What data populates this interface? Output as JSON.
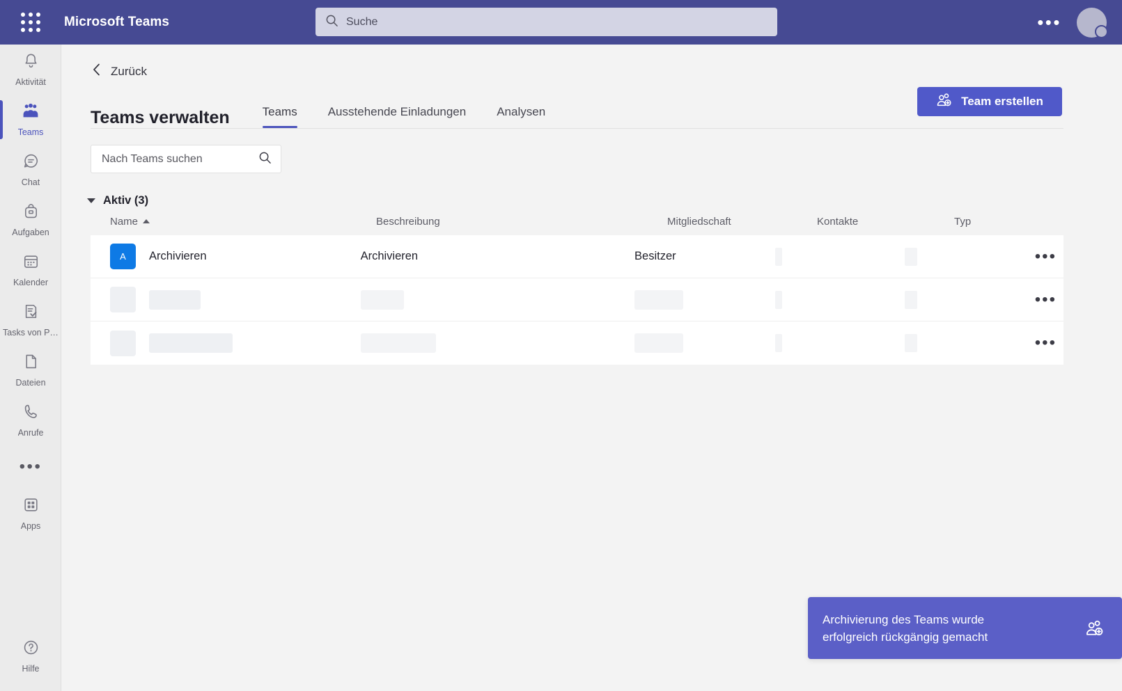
{
  "topbar": {
    "waffle_icon": "app-launcher-icon",
    "brand": "Microsoft Teams",
    "search_placeholder": "Suche",
    "search_value": "",
    "search_icon": "search-icon",
    "more_label": "•••",
    "avatar_icon": "user-avatar"
  },
  "rail": {
    "items": [
      {
        "label": "Aktivität",
        "icon": "bell-icon",
        "active": false
      },
      {
        "label": "Teams",
        "icon": "people-icon",
        "active": true
      },
      {
        "label": "Chat",
        "icon": "chat-bubble-icon",
        "active": false
      },
      {
        "label": "Aufgaben",
        "icon": "backpack-icon",
        "active": false
      },
      {
        "label": "Kalender",
        "icon": "calendar-icon",
        "active": false
      },
      {
        "label": "Tasks von P…",
        "icon": "task-list-icon",
        "active": false
      },
      {
        "label": "Dateien",
        "icon": "file-icon",
        "active": false
      },
      {
        "label": "Anrufe",
        "icon": "phone-icon",
        "active": false
      }
    ],
    "more_label": "•••",
    "apps": {
      "label": "Apps",
      "icon": "grid-apps-icon"
    },
    "help": {
      "label": "Hilfe",
      "icon": "question-circle-icon"
    }
  },
  "content": {
    "back_label": "Zurück",
    "back_icon": "chevron-left-icon",
    "page_title": "Teams verwalten",
    "tabs": [
      {
        "label": "Teams",
        "active": true
      },
      {
        "label": "Ausstehende Einladungen",
        "active": false
      },
      {
        "label": "Analysen",
        "active": false
      }
    ],
    "create_button": {
      "label": "Team erstellen",
      "icon": "add-person-icon"
    },
    "team_search": {
      "placeholder": "Nach Teams suchen",
      "value": "",
      "icon": "search-icon"
    },
    "group": {
      "label": "Aktiv (3)",
      "expanded": true,
      "caret_icon": "chevron-down-icon"
    }
  },
  "table": {
    "columns": [
      {
        "key": "name",
        "label": "Name",
        "sort": "asc"
      },
      {
        "key": "description",
        "label": "Beschreibung",
        "sort": null
      },
      {
        "key": "membership",
        "label": "Mitgliedschaft",
        "sort": null
      },
      {
        "key": "contacts",
        "label": "Kontakte",
        "sort": null
      },
      {
        "key": "type",
        "label": "Typ",
        "sort": null
      }
    ],
    "row_menu_label": "•••",
    "rows": [
      {
        "loading": false,
        "avatar_initial": "A",
        "avatar_color": "#0e7ae5",
        "name": "Archivieren",
        "description": "Archivieren",
        "membership": "Besitzer",
        "contacts": "",
        "type": ""
      },
      {
        "loading": true,
        "avatar_initial": "",
        "name": "",
        "description": "",
        "membership": "",
        "contacts": "",
        "type": ""
      },
      {
        "loading": true,
        "avatar_initial": "",
        "name": "",
        "description": "",
        "membership": "",
        "contacts": "",
        "type": ""
      }
    ]
  },
  "toast": {
    "message": "Archivierung des Teams wurde erfolgreich rückgängig gemacht",
    "icon": "add-person-icon",
    "color": "#5b5fc7"
  },
  "colors": {
    "topbar": "#464a93",
    "accent": "#5059c9",
    "rail_active": "#4b53bc",
    "panel_bg": "#f3f3f3",
    "row_bg": "#ffffff"
  }
}
